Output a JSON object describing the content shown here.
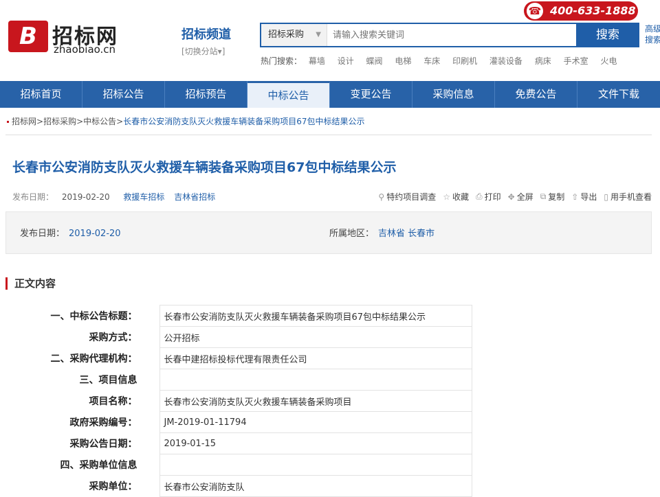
{
  "logo": {
    "mark": "B",
    "cn": "招标网",
    "en": "zhaobiao.cn"
  },
  "channel": {
    "title": "招标频道",
    "switch": "[切换分站▾]"
  },
  "hotline": {
    "icon": "phone-icon",
    "number": "400-633-1888"
  },
  "search": {
    "category": "招标采购",
    "placeholder": "请输入搜索关键词",
    "button": "搜索",
    "advanced": "高级搜索"
  },
  "hot": {
    "label": "热门搜索：",
    "items": [
      "幕墙",
      "设计",
      "蝶阀",
      "电梯",
      "车床",
      "印刷机",
      "灌装设备",
      "病床",
      "手术室",
      "火电"
    ]
  },
  "nav": [
    "招标首页",
    "招标公告",
    "招标预告",
    "中标公告",
    "变更公告",
    "采购信息",
    "免费公告",
    "文件下载"
  ],
  "breadcrumb": [
    "招标网",
    "招标采购",
    "中标公告",
    "长春市公安消防支队灭火救援车辆装备采购项目67包中标结果公示"
  ],
  "article": {
    "title": "长春市公安消防支队灭火救援车辆装备采购项目67包中标结果公示",
    "date_label": "发布日期：",
    "date": "2019-02-20",
    "tags": [
      "救援车招标",
      "吉林省招标"
    ],
    "tools": [
      {
        "icon": "search-icon",
        "label": "特约项目调查"
      },
      {
        "icon": "star-icon",
        "label": "收藏"
      },
      {
        "icon": "printer-icon",
        "label": "打印"
      },
      {
        "icon": "fullscreen-icon",
        "label": "全屏"
      },
      {
        "icon": "copy-icon",
        "label": "复制"
      },
      {
        "icon": "export-icon",
        "label": "导出"
      },
      {
        "icon": "mobile-icon",
        "label": "用手机查看"
      }
    ],
    "info": {
      "date_label": "发布日期：",
      "date": "2019-02-20",
      "region_label": "所属地区：",
      "region": "吉林省 长春市"
    },
    "section_title": "正文内容",
    "rows": [
      {
        "k": "一、中标公告标题：",
        "v": "长春市公安消防支队灭火救援车辆装备采购项目67包中标结果公示"
      },
      {
        "k": "采购方式：",
        "v": "公开招标"
      },
      {
        "k": "二、采购代理机构：",
        "v": "长春中建招标投标代理有限责任公司"
      },
      {
        "k": "三、项目信息",
        "v": ""
      },
      {
        "k": "项目名称：",
        "v": "长春市公安消防支队灭火救援车辆装备采购项目"
      },
      {
        "k": "政府采购编号：",
        "v": "JM-2019-01-11794"
      },
      {
        "k": "采购公告日期：",
        "v": "2019-01-15"
      },
      {
        "k": "四、采购单位信息",
        "v": ""
      },
      {
        "k": "采购单位：",
        "v": "长春市公安消防支队"
      }
    ]
  }
}
